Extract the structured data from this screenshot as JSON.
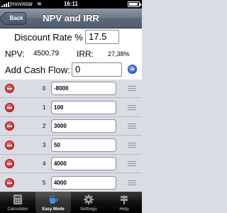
{
  "status_bar": {
    "carrier": "movistar",
    "wifi": "≋",
    "time": "16:11"
  },
  "nav": {
    "back_label": "Back",
    "title": "NPV and IRR"
  },
  "form": {
    "discount_label": "Discount Rate %",
    "discount_value": "17.5",
    "npv_label": "NPV:",
    "npv_value": "4500,79",
    "irr_label": "IRR:",
    "irr_value": "27,38%",
    "add_cf_label": "Add Cash Flow:",
    "add_cf_value": "0",
    "add_button_glyph": "➜"
  },
  "cash_flows": [
    {
      "index": "0",
      "value": "-8000"
    },
    {
      "index": "1",
      "value": "100"
    },
    {
      "index": "2",
      "value": "3000"
    },
    {
      "index": "3",
      "value": "50"
    },
    {
      "index": "4",
      "value": "4000"
    },
    {
      "index": "5",
      "value": "4000"
    }
  ],
  "tabs": [
    {
      "label": "Calculator",
      "icon": "calculator-icon",
      "active": false
    },
    {
      "label": "Easy Mode",
      "icon": "coffee-cup-icon",
      "active": true
    },
    {
      "label": "Settings",
      "icon": "gear-icon",
      "active": false
    },
    {
      "label": "Help",
      "icon": "signpost-icon",
      "active": false
    }
  ],
  "colors": {
    "accent_blue": "#1e55c7",
    "delete_red": "#c31616",
    "nav_gray": "#6c7686"
  }
}
